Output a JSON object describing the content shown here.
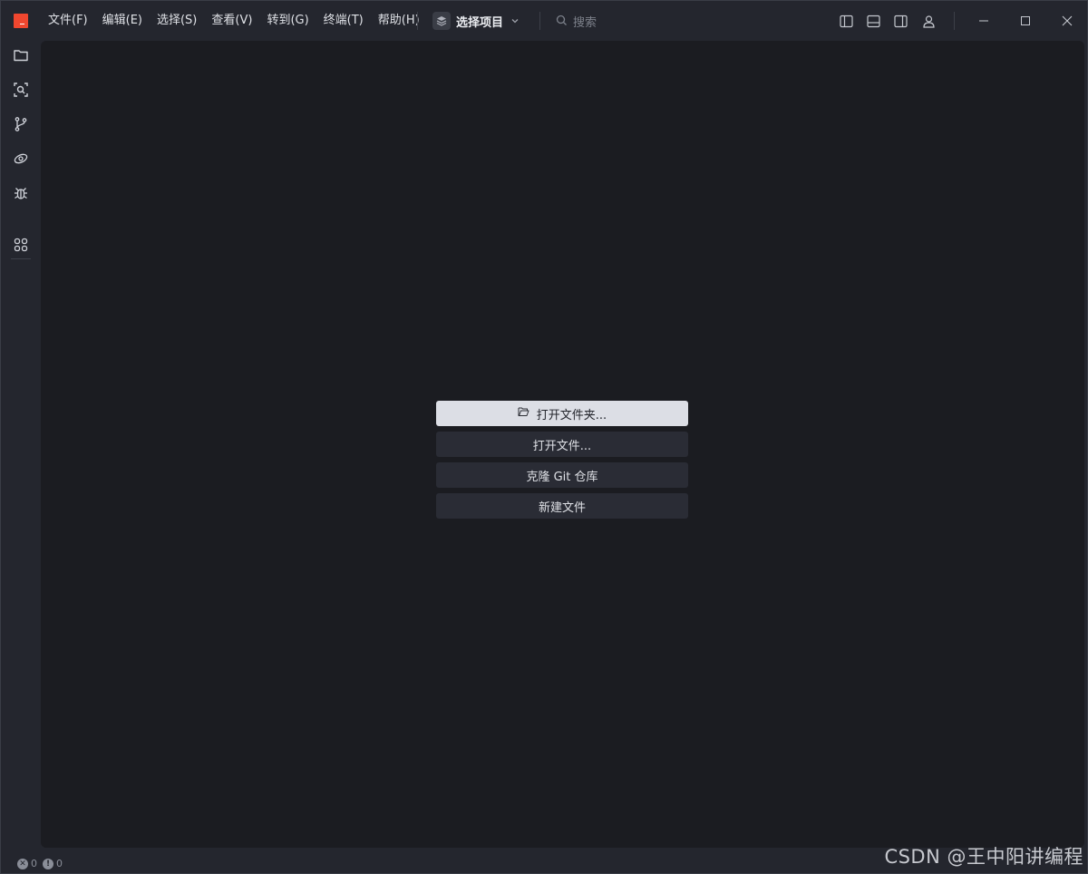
{
  "menubar": {
    "items": [
      "文件(F)",
      "编辑(E)",
      "选择(S)",
      "查看(V)",
      "转到(G)",
      "终端(T)",
      "帮助(H)"
    ]
  },
  "project": {
    "label": "选择项目",
    "icon": "layers-icon"
  },
  "search": {
    "placeholder": "搜索"
  },
  "activitybar": {
    "icons": [
      "folder-icon",
      "search-scope-icon",
      "source-control-icon",
      "remote-explorer-icon",
      "debug-icon",
      "extensions-icon"
    ]
  },
  "welcome": {
    "actions": [
      {
        "label": "打开文件夹...",
        "icon": "folder-open-icon",
        "primary": true
      },
      {
        "label": "打开文件...",
        "primary": false
      },
      {
        "label": "克隆 Git 仓库",
        "primary": false
      },
      {
        "label": "新建文件",
        "primary": false
      }
    ]
  },
  "status": {
    "errors": "0",
    "warnings": "0"
  },
  "watermark": "CSDN @王中阳讲编程",
  "colors": {
    "logo": "#f0472f",
    "background": "#24262e",
    "editor": "#1b1c21",
    "primary_button": "#dcdee5",
    "secondary_button": "#2a2c35"
  }
}
